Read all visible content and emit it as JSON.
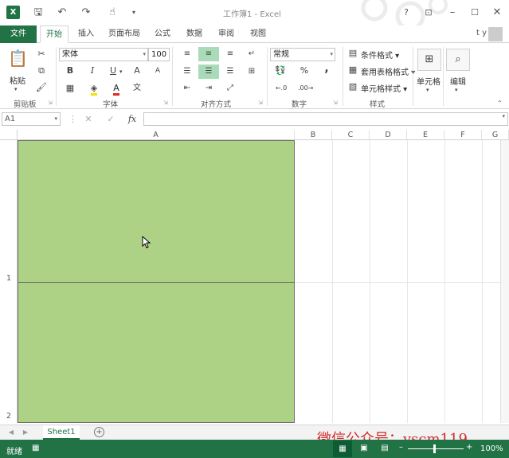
{
  "window": {
    "title": "工作簿1 - Excel",
    "app_icon": "excel-icon",
    "user": "t y"
  },
  "tabs": [
    {
      "label": "文件"
    },
    {
      "label": "开始"
    },
    {
      "label": "插入"
    },
    {
      "label": "页面布局"
    },
    {
      "label": "公式"
    },
    {
      "label": "数据"
    },
    {
      "label": "审阅"
    },
    {
      "label": "视图"
    }
  ],
  "ribbon": {
    "clipboard": {
      "paste": "粘贴",
      "group": "剪贴板"
    },
    "font": {
      "name": "宋体",
      "size": "100",
      "bold": "B",
      "italic": "I",
      "underline": "U",
      "grow": "A",
      "shrink": "A",
      "color": "A",
      "phonetic": "文",
      "group": "字体"
    },
    "alignment": {
      "group": "对齐方式"
    },
    "number": {
      "format": "常规",
      "percent": "%",
      "comma": ",",
      "group": "数字"
    },
    "styles": {
      "conditional": "条件格式",
      "table": "套用表格格式",
      "cell": "单元格样式",
      "group": "样式"
    },
    "cells": {
      "label": "单元格"
    },
    "editing": {
      "label": "编辑"
    }
  },
  "formula_bar": {
    "name_box": "A1",
    "fx": "fx",
    "value": ""
  },
  "columns": [
    "A",
    "B",
    "C",
    "D",
    "E",
    "F",
    "G"
  ],
  "rows": [
    "1",
    "2"
  ],
  "sheets": [
    {
      "name": "Sheet1"
    }
  ],
  "watermark": "微信公众号：yscm119",
  "status": {
    "ready": "就绪",
    "zoom": "100%"
  },
  "colors": {
    "accent": "#217346",
    "cell_fill": "#aed285",
    "selected_align": "#a9dbb8"
  }
}
